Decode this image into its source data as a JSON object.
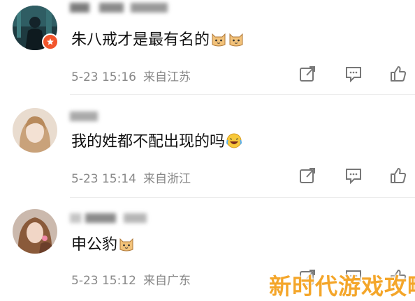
{
  "comments": [
    {
      "text": "朱八戒才是最有名的",
      "emoji": [
        "cat-face-icon",
        "cat-face-icon"
      ],
      "time": "5-23 15:16",
      "location": "来自江苏"
    },
    {
      "text": "我的姓都不配出现的吗",
      "emoji": [
        "laugh-cry-icon"
      ],
      "time": "5-23 15:14",
      "location": "来自浙江"
    },
    {
      "text": "申公豹",
      "emoji": [
        "cat-face-icon"
      ],
      "time": "5-23 15:12",
      "location": "来自广东"
    }
  ],
  "actions": [
    "share-icon",
    "comment-icon",
    "like-icon"
  ],
  "watermark": "新时代游戏攻略",
  "colors": {
    "meta": "#888888",
    "verify": "#f2552c",
    "watermark": "#f4a62a"
  }
}
